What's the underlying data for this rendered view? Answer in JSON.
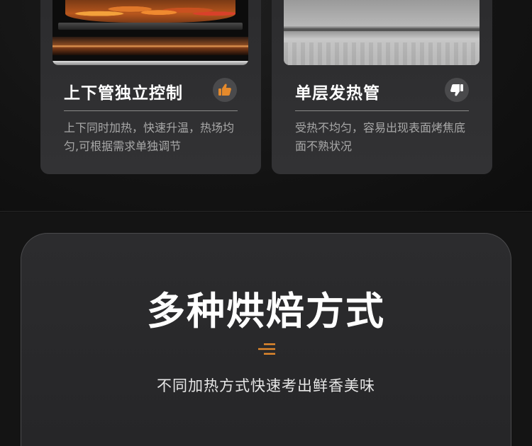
{
  "cards": [
    {
      "title": "上下管独立控制",
      "description": "上下同时加热，快速升温，热场均匀,可根据需求单独调节",
      "rating_icon": "thumbs-up-icon",
      "rating_color": "#e58a2c"
    },
    {
      "title": "单层发热管",
      "description": "受热不均匀，容易出现表面烤焦底面不熟状况",
      "rating_icon": "thumbs-down-icon",
      "rating_color": "#ffffff"
    }
  ],
  "section": {
    "title": "多种烘焙方式",
    "subtitle": "不同加热方式快速考出鲜香美味",
    "accent_icon": "menu-lines-icon",
    "accent_color": "#e58a2c"
  }
}
